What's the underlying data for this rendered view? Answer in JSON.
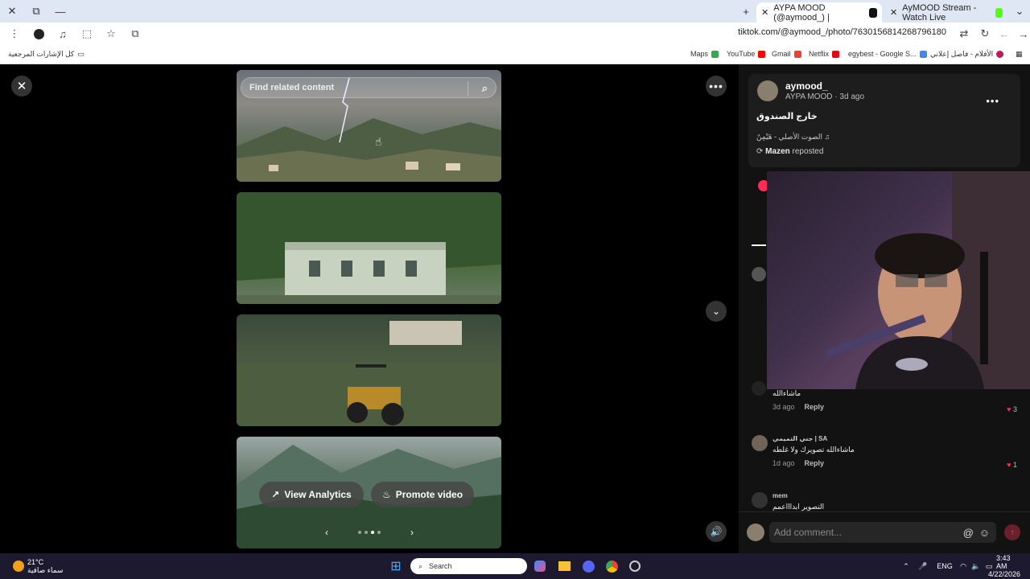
{
  "browser": {
    "tabs": [
      {
        "label": "AYPA MOOD (@aymood_) |",
        "active": true
      },
      {
        "label": "AyMOOD Stream - Watch Live",
        "active": false
      }
    ],
    "url": "tiktok.com/@aymood_/photo/7630156814268796180",
    "bookmarks": [
      {
        "label": "Maps"
      },
      {
        "label": "YouTube"
      },
      {
        "label": "Gmail"
      },
      {
        "label": "Netflix"
      },
      {
        "label": "egybest - Google S..."
      },
      {
        "label": "الأفلام - فاصل إعلاني"
      }
    ],
    "all_bookmarks": "كل الإشارات المرجعية"
  },
  "viewer": {
    "search_placeholder": "Find related content",
    "view_analytics": "View Analytics",
    "promote_video": "Promote video"
  },
  "post": {
    "username": "aymood_",
    "subline": "AYPA MOOD · 3d ago",
    "caption": "خارج الصندوق",
    "sound": "الصوت الأصلي - هَيْمِنٌ",
    "repost_user": "Mazen",
    "repost_label": "reposted"
  },
  "comments": [
    {
      "text": "ماشاءالله",
      "time": "3d ago",
      "reply": "Reply",
      "likes": "3"
    },
    {
      "user": "جني التميمي | SA",
      "text": "ماشاءالله تصويرك ولا غلطه",
      "time": "1d ago",
      "reply": "Reply",
      "likes": "1"
    },
    {
      "user": "mem",
      "text": "التصوير ابداااعمم"
    }
  ],
  "comment_input": {
    "placeholder": "Add comment..."
  },
  "taskbar": {
    "weather_temp": "21°C",
    "weather_desc": "سماء صافية",
    "search": "Search",
    "lang": "ENG",
    "time": "3:43 AM",
    "date": "4/22/2026"
  }
}
